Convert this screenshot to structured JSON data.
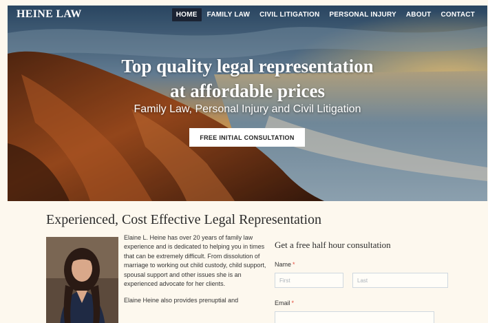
{
  "brand": "HEINE LAW",
  "nav": {
    "items": [
      {
        "label": "HOME",
        "active": true
      },
      {
        "label": "FAMILY LAW",
        "active": false
      },
      {
        "label": "CIVIL LITIGATION",
        "active": false
      },
      {
        "label": "PERSONAL INJURY",
        "active": false
      },
      {
        "label": "ABOUT",
        "active": false
      },
      {
        "label": "CONTACT",
        "active": false
      }
    ]
  },
  "hero": {
    "headline_line1": "Top quality legal representation",
    "headline_line2": "at affordable prices",
    "subline": "Family Law, Personal Injury and Civil Litigation",
    "cta_label": "FREE INITIAL CONSULTATION"
  },
  "section": {
    "title": "Experienced, Cost Effective Legal Representation",
    "bio_paragraph1": "Elaine L. Heine has over 20 years of family law experience and is dedicated to helping you in times that can be extremely difficult. From dissolution of marriage to working out child custody, child support, spousal support and other issues she is an experienced advocate for her clients.",
    "bio_paragraph2": "Elaine Heine also provides prenuptial and"
  },
  "form": {
    "title": "Get a free half hour consultation",
    "name_label": "Name",
    "first_placeholder": "First",
    "last_placeholder": "Last",
    "email_label": "Email",
    "required_marker": "*"
  },
  "colors": {
    "nav_active_bg": "#1b2333",
    "page_bg": "#fdf8ee",
    "required": "#e34a3b"
  }
}
